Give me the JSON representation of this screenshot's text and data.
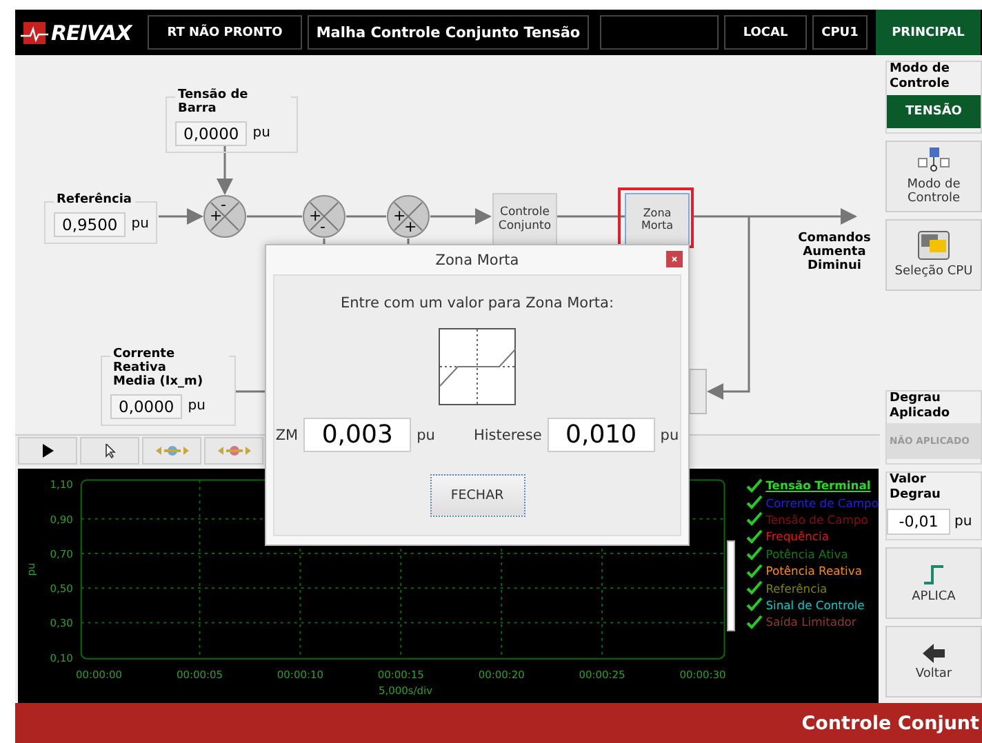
{
  "header": {
    "logo": "REIVAX",
    "status": "RT NÃO PRONTO",
    "title": "Malha Controle Conjunto Tensão",
    "mode": "LOCAL",
    "cpu": "CPU1",
    "role": "PRINCIPAL"
  },
  "diagram": {
    "bus_voltage": {
      "label": "Tensão de Barra",
      "value": "0,0000",
      "unit": "pu"
    },
    "reference": {
      "label": "Referência",
      "value": "0,9500",
      "unit": "pu"
    },
    "reactive_current": {
      "label": "Corrente Reativa\nMedia (Ix_m)",
      "value": "0,0000",
      "unit": "pu"
    },
    "summers": [
      {
        "left": "+",
        "top": "-"
      },
      {
        "left": "+",
        "bottom": "-"
      },
      {
        "left": "+",
        "bottom": "+"
      }
    ],
    "blocks": [
      {
        "label": "Controle Conjunto",
        "selected": false
      },
      {
        "label": "Zona Morta",
        "selected": true
      }
    ],
    "output_label": "Comandos Aumenta Diminui"
  },
  "chart": {
    "ylabel": "pu",
    "yticks": [
      "1,10",
      "0,90",
      "0,70",
      "0,50",
      "0,30",
      "0,10"
    ],
    "xticks": [
      "00:00:00",
      "00:00:05",
      "00:00:10",
      "00:00:15",
      "00:00:20",
      "00:00:25",
      "00:00:30"
    ],
    "xlabel": "5,000s/div",
    "legend": [
      {
        "label": "Tensão Terminal",
        "color": "#22dd22",
        "checked": true,
        "selected": true
      },
      {
        "label": "Corrente de Campo",
        "color": "#2020e0",
        "checked": true,
        "selected": false
      },
      {
        "label": "Tensão de Campo",
        "color": "#8b0a0a",
        "checked": true,
        "selected": false
      },
      {
        "label": "Frequência",
        "color": "#ee1111",
        "checked": true,
        "selected": false
      },
      {
        "label": "Potência Ativa",
        "color": "#127a12",
        "checked": true,
        "selected": false
      },
      {
        "label": "Potência Reativa",
        "color": "#ff8c00",
        "checked": true,
        "selected": false
      },
      {
        "label": "Referência",
        "color": "#808000",
        "checked": true,
        "selected": false
      },
      {
        "label": "Sinal de Controle",
        "color": "#00cccc",
        "checked": true,
        "selected": false
      },
      {
        "label": "Saída Limitador",
        "color": "#8b3a3a",
        "checked": true,
        "selected": false
      }
    ]
  },
  "dialog": {
    "title": "Zona Morta",
    "prompt": "Entre com um valor para Zona Morta:",
    "zm_label": "ZM",
    "zm_value": "0,003",
    "zm_unit": "pu",
    "hyst_label": "Histerese",
    "hyst_value": "0,010",
    "hyst_unit": "pu",
    "button": "FECHAR"
  },
  "side": {
    "mode_group": "Modo de Controle",
    "mode_value": "TENSÃO",
    "buttons": [
      {
        "label": "Modo de Controle",
        "kind": "mode"
      },
      {
        "label": "Seleção CPU",
        "kind": "cpu"
      }
    ],
    "step_group": "Degrau Aplicado",
    "step_status": "NÃO APLICADO",
    "step_disabled": true,
    "value_group": "Valor Degrau",
    "value": "-0,01",
    "unit": "pu",
    "actions": [
      {
        "label": "APLICA",
        "kind": "step"
      },
      {
        "label": "Voltar",
        "kind": "back"
      }
    ]
  },
  "footer": "Controle Conjunt"
}
